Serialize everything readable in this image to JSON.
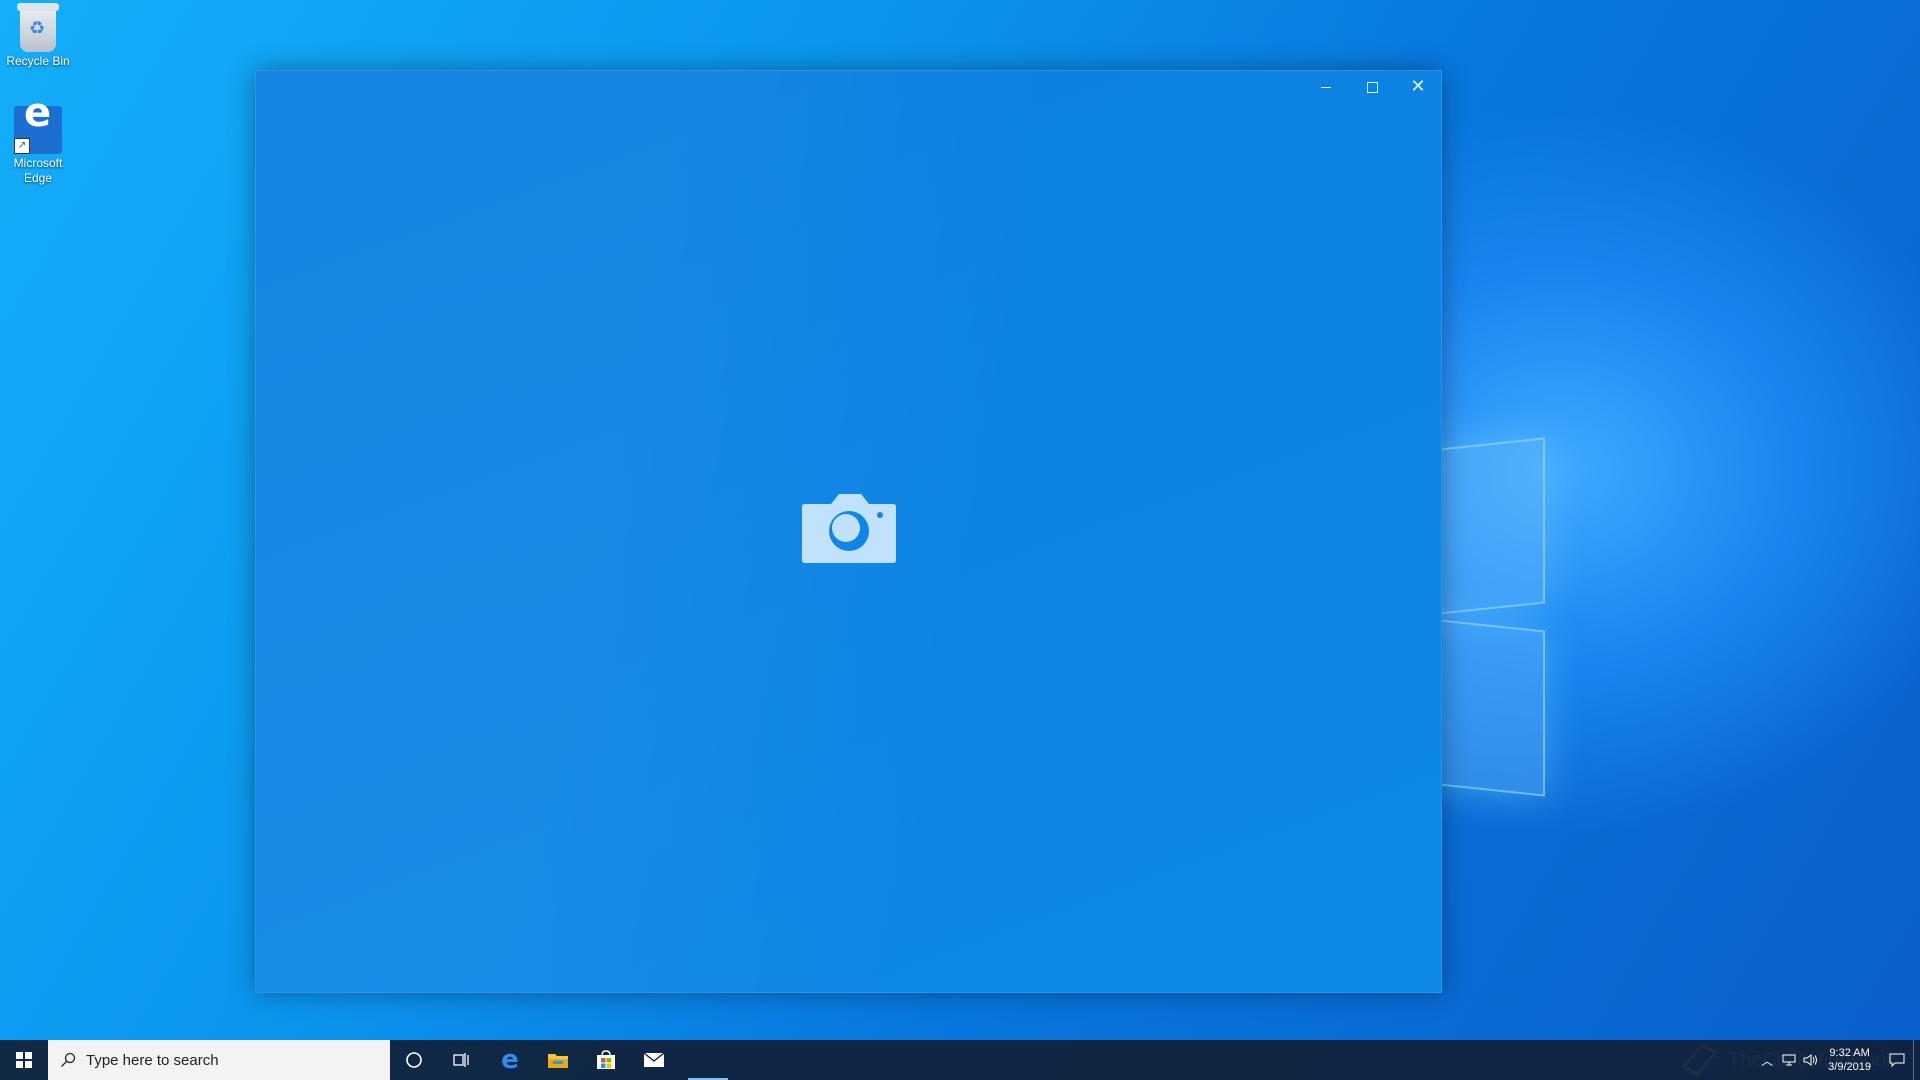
{
  "desktop": {
    "icons": [
      {
        "label": "Recycle Bin"
      },
      {
        "label": "Microsoft Edge"
      }
    ]
  },
  "window": {
    "controls": {
      "minimize": "–",
      "maximize": "□",
      "close": "✕"
    },
    "content_icon": "camera-icon"
  },
  "taskbar": {
    "search_placeholder": "Type here to search",
    "pinned": [
      "cortana-icon",
      "task-view-icon",
      "edge-icon",
      "file-explorer-icon",
      "store-icon",
      "mail-icon"
    ],
    "active_app": "camera",
    "clock": {
      "time": "9:32 AM",
      "date": "3/9/2019"
    }
  },
  "watermark": {
    "text": "TheCollectionBook"
  },
  "colors": {
    "accent": "#0a84e6",
    "taskbar": "#102036"
  }
}
